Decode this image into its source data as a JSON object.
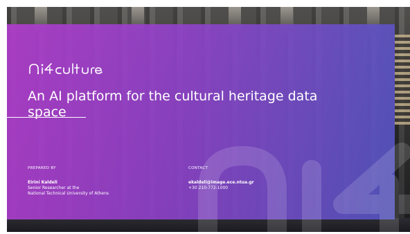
{
  "slide": {
    "logo_text": "ai4culture",
    "title": "An AI platform for the cultural heritage data space",
    "prepared_by": {
      "label": "PREPARED BY",
      "name": "Eirini Kaldeli",
      "role": "Senior Researcher at the",
      "organization": "National Technical University of Athens"
    },
    "contact": {
      "label": "CONTACT",
      "email": "ekaldeli@image.ece.ntua.gr",
      "phone": "+30 210-772-1000"
    }
  },
  "colors": {
    "gradient_start": "#b03ccc",
    "gradient_end": "#5456c4",
    "text": "#ffffff"
  }
}
